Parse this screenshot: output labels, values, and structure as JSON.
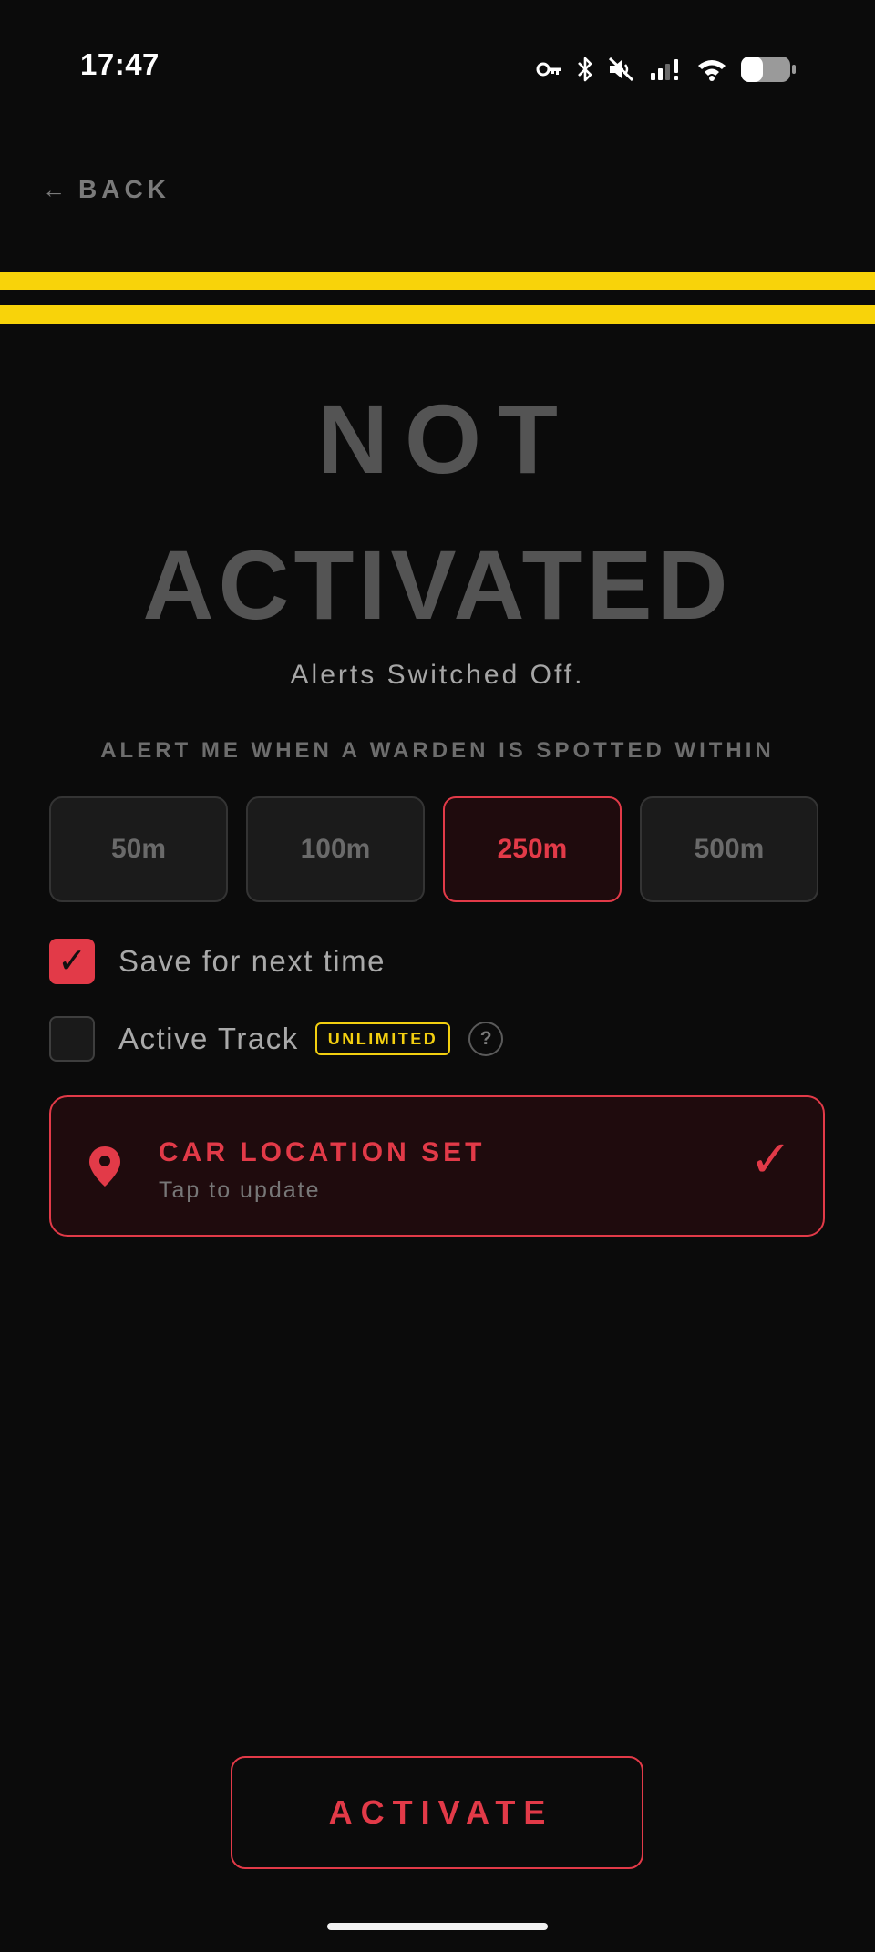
{
  "status_bar": {
    "time": "17:47",
    "icons": [
      "vpn-key-icon",
      "bluetooth-icon",
      "mute-icon",
      "signal-icon",
      "wifi-icon",
      "battery-icon"
    ]
  },
  "nav": {
    "back_arrow": "←",
    "back_label": "BACK"
  },
  "status": {
    "line1": "NOT",
    "line2": "ACTIVATED",
    "subtitle": "Alerts Switched Off."
  },
  "radius": {
    "prompt": "ALERT ME WHEN A WARDEN IS SPOTTED WITHIN",
    "options": [
      {
        "label": "50m",
        "selected": false
      },
      {
        "label": "100m",
        "selected": false
      },
      {
        "label": "250m",
        "selected": true
      },
      {
        "label": "500m",
        "selected": false
      }
    ]
  },
  "options": {
    "save": {
      "label": "Save for next time",
      "checked": true,
      "tick": "✓"
    },
    "active_track": {
      "label": "Active Track",
      "checked": false,
      "badge": "UNLIMITED",
      "help": "?"
    }
  },
  "car_location": {
    "title": "CAR LOCATION SET",
    "subtitle": "Tap to update",
    "check": "✓"
  },
  "actions": {
    "activate_label": "ACTIVATE"
  },
  "colors": {
    "background": "#0b0b0b",
    "accent_red": "#e23a48",
    "accent_yellow": "#f8d30a",
    "muted_gray": "#545454"
  }
}
